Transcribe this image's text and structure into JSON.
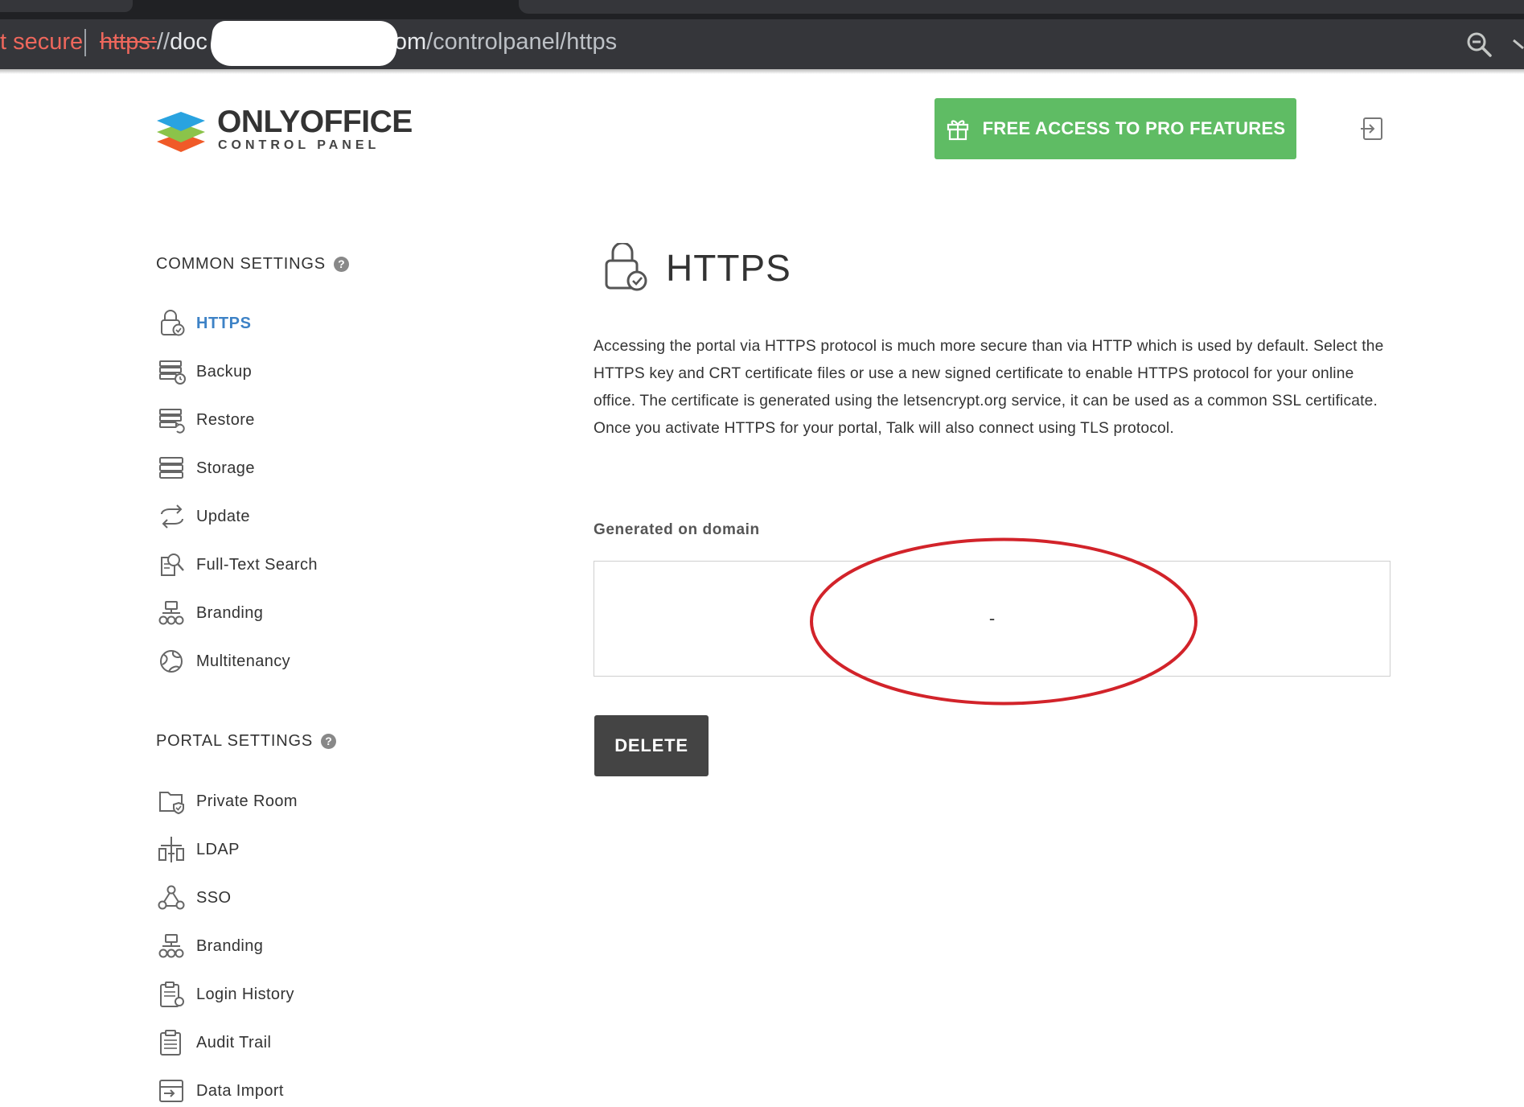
{
  "browser": {
    "security_label": "t secure",
    "url_scheme": "https:",
    "url_slashes": "//",
    "url_host_start": "doc",
    "url_host_end": "om",
    "url_path": "/controlpanel/https"
  },
  "header": {
    "logo_name": "ONLYOFFICE",
    "logo_subtitle": "CONTROL PANEL",
    "pro_button_label": "FREE ACCESS TO PRO FEATURES",
    "pro_button_color": "#5fbc64"
  },
  "sidebar": {
    "common_settings": {
      "title": "COMMON SETTINGS",
      "help": "?",
      "items": [
        {
          "label": "HTTPS",
          "icon": "lock-check-icon",
          "active": true
        },
        {
          "label": "Backup",
          "icon": "backup-icon"
        },
        {
          "label": "Restore",
          "icon": "restore-icon"
        },
        {
          "label": "Storage",
          "icon": "storage-icon"
        },
        {
          "label": "Update",
          "icon": "update-icon"
        },
        {
          "label": "Full-Text Search",
          "icon": "search-document-icon"
        },
        {
          "label": "Branding",
          "icon": "branding-icon"
        },
        {
          "label": "Multitenancy",
          "icon": "globe-icon"
        }
      ]
    },
    "portal_settings": {
      "title": "PORTAL SETTINGS",
      "help": "?",
      "items": [
        {
          "label": "Private Room",
          "icon": "folder-shield-icon"
        },
        {
          "label": "LDAP",
          "icon": "ldap-icon"
        },
        {
          "label": "SSO",
          "icon": "sso-icon"
        },
        {
          "label": "Branding",
          "icon": "branding-icon"
        },
        {
          "label": "Login History",
          "icon": "login-history-icon"
        },
        {
          "label": "Audit Trail",
          "icon": "audit-trail-icon"
        },
        {
          "label": "Data Import",
          "icon": "data-import-icon"
        }
      ]
    },
    "active_color": "#3d82c6"
  },
  "main": {
    "title": "HTTPS",
    "description": "Accessing the portal via HTTPS protocol is much more secure than via HTTP which is used by default. Select the HTTPS key and CRT certificate files or use a new signed certificate to enable HTTPS protocol for your online office. The certificate is generated using the letsencrypt.org service, it can be used as a common SSL certificate. Once you activate HTTPS for your portal, Talk will also connect using TLS protocol.",
    "generated_on_domain_label": "Generated on domain",
    "generated_on_domain_value": "-",
    "delete_button_label": "DELETE",
    "annotation_color": "#d2232a"
  }
}
